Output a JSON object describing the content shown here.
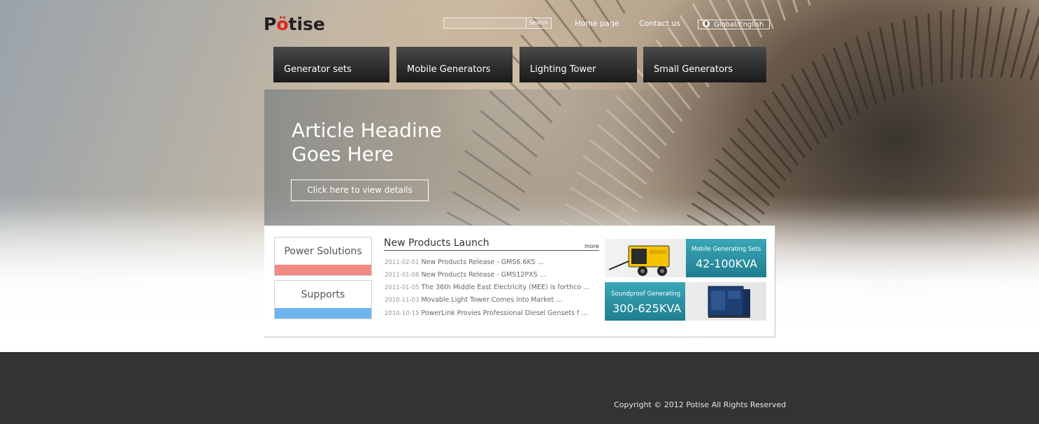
{
  "brand": {
    "logo_text_pre": "P",
    "logo_text_dot": "ö",
    "logo_text_post": "tise"
  },
  "header": {
    "search_placeholder": "",
    "search_button": "Search",
    "home_link": "Home page",
    "contact_link": "Contact us",
    "language": "Global/English"
  },
  "nav": {
    "tabs": [
      {
        "label": "Generator sets"
      },
      {
        "label": "Mobile Generators"
      },
      {
        "label": "Lighting Tower"
      },
      {
        "label": "Small Generators"
      }
    ]
  },
  "hero": {
    "headline_line1": "Article Headine",
    "headline_line2": "Goes Here",
    "button": "Click here to view details"
  },
  "side": {
    "power_solutions": "Power Solutions",
    "supports": "Supports",
    "colors": {
      "power": "#f28b84",
      "supports": "#6fb3ee"
    }
  },
  "news": {
    "title": "New Products Launch",
    "more": "more",
    "items": [
      {
        "date": "2011-02-01",
        "text": "New Products Release - GMS6.6KS ..."
      },
      {
        "date": "2011-01-08",
        "text": "New Products Release - GMS12PXS ..."
      },
      {
        "date": "2011-01-05",
        "text": "The 36th Middle East Electricity (MEE) is forthco ..."
      },
      {
        "date": "2010-11-03",
        "text": "Movable Light Tower Comes into Market ..."
      },
      {
        "date": "2010-10-15",
        "text": "PowerLink Provies Professional Diesel Gensets f ..."
      }
    ]
  },
  "promos": [
    {
      "small": "Mobile Generating Sets",
      "big": "42-100KVA"
    },
    {
      "small": "Soundproof Generating",
      "big": "300-625KVA"
    }
  ],
  "footer": {
    "copyright": "Copyright © 2012 Potise  All Rights Reserved"
  },
  "colors": {
    "teal": "#2a90a2",
    "footer_bg": "#333333",
    "nav_bg": "#2f2f2f"
  }
}
